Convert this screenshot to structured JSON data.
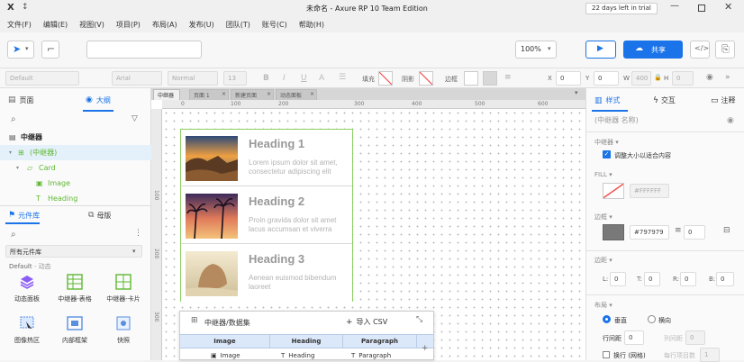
{
  "titlebar": {
    "title": "未命名 - Axure RP 10 Team Edition",
    "trial": "22 days left in trial"
  },
  "menu": [
    "文件(F)",
    "编辑(E)",
    "视图(V)",
    "项目(P)",
    "布局(A)",
    "发布(U)",
    "团队(T)",
    "账号(C)",
    "帮助(H)"
  ],
  "toolbar": {
    "zoom": "100%",
    "share_label": "共享"
  },
  "stylebar": {
    "style_value": "Default",
    "font_value": "Arial",
    "weight_value": "Normal",
    "size_value": "13",
    "fill_label": "填充",
    "shadow_label": "阴影",
    "border_label": "边框",
    "x_label": "X",
    "x_value": "0",
    "y_label": "Y",
    "y_value": "0",
    "w_label": "W",
    "w_value": "400",
    "h_label": "H",
    "h_value": "0"
  },
  "leftpanel": {
    "tab_pages": "页面",
    "tab_outline": "大纲",
    "tree": [
      {
        "label": "中继器",
        "indent": 0,
        "icon": "page-icon",
        "bold": true,
        "selected": false
      },
      {
        "label": "(中继器)",
        "indent": 1,
        "icon": "repeater-icon",
        "bold": false,
        "selected": true
      },
      {
        "label": "Card",
        "indent": 2,
        "icon": "folder-icon",
        "bold": false,
        "selected": false
      },
      {
        "label": "Image",
        "indent": 3,
        "icon": "image-icon",
        "bold": false,
        "selected": false
      },
      {
        "label": "Heading",
        "indent": 3,
        "icon": "text-icon",
        "bold": false,
        "selected": false
      }
    ],
    "tab_library": "元件库",
    "tab_masters": "母版",
    "library_select": "所有元件库",
    "library_group": "Default",
    "library_subgroup": "动态",
    "widgets_row1": [
      "动态面板",
      "中继器-表格",
      "中继器-卡片"
    ],
    "widgets_row2": [
      "图像热区",
      "内部框架",
      "快照"
    ]
  },
  "canvas": {
    "tabs": [
      "中继器",
      "页面 1",
      "新建页面",
      "动态面板"
    ],
    "ruler_h": [
      "0",
      "100",
      "200",
      "300",
      "400",
      "500",
      "600"
    ],
    "ruler_v": [
      "100",
      "200",
      "300"
    ],
    "cards": [
      {
        "heading": "Heading 1",
        "text": "Lorem ipsum dolor sit amet, consectetur adipiscing elit",
        "img": "sunset-rocks"
      },
      {
        "heading": "Heading 2",
        "text": "Proin gravida dolor sit amet lacus accumsan et viverra",
        "img": "palm-sunset"
      },
      {
        "heading": "Heading 3",
        "text": "Aenean euismod bibendum laoreet",
        "img": "beach-rock"
      }
    ]
  },
  "dataset": {
    "title": "中继器/数据集",
    "import_label": "导入 CSV",
    "columns": [
      "Image",
      "Heading",
      "Paragraph"
    ],
    "row1": [
      "Image",
      "Heading",
      "Paragraph"
    ]
  },
  "rightpanel": {
    "tab_style": "样式",
    "tab_interact": "交互",
    "tab_notes": "注释",
    "name_placeholder": "(中继器 名称)",
    "repeater_section": "中继器",
    "fit_content_label": "调整大小以适合内容",
    "fill_section": "FILL",
    "fill_value": "#FFFFFF",
    "border_section": "边框",
    "border_color": "#797979",
    "border_width": "0",
    "padding_section": "边距",
    "pad_l_label": "L:",
    "pad_l": "0",
    "pad_t_label": "T:",
    "pad_t": "0",
    "pad_r_label": "R:",
    "pad_r": "0",
    "pad_b_label": "B:",
    "pad_b": "0",
    "layout_section": "布局",
    "vertical_label": "垂直",
    "horizontal_label": "横向",
    "row_spacing_label": "行间距",
    "row_spacing": "0",
    "col_spacing_label": "列间距",
    "col_spacing": "0",
    "wrap_label": "换行 (网格)",
    "per_row_label": "每行项目数",
    "per_row": "1",
    "colors": {
      "accent": "#1a73e8",
      "selected_bg": "#e4f1fb",
      "green": "#5fb832"
    }
  }
}
